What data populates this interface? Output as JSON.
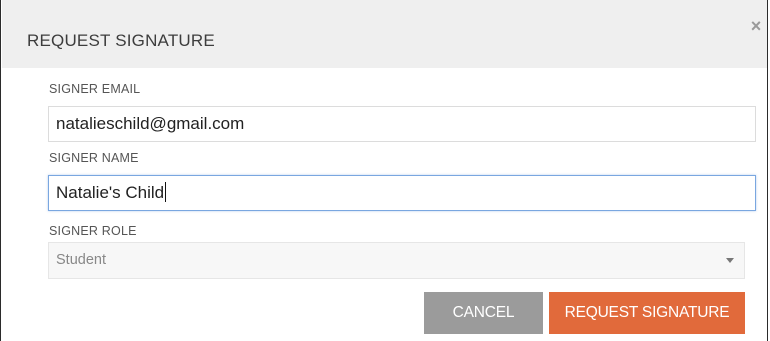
{
  "modal": {
    "title": "REQUEST SIGNATURE",
    "close_glyph": "×"
  },
  "fields": {
    "email": {
      "label": "SIGNER EMAIL",
      "value": "natalieschild@gmail.com"
    },
    "name": {
      "label": "SIGNER NAME",
      "value": "Natalie's Child"
    },
    "role": {
      "label": "SIGNER ROLE",
      "selected": "Student"
    }
  },
  "buttons": {
    "cancel_label": "CANCEL",
    "request_label": "REQUEST SIGNATURE"
  },
  "icons": {
    "close": "close-icon",
    "dropdown": "chevron-down-icon"
  },
  "colors": {
    "header_bg": "#efefef",
    "cancel_bg": "#9b9b9b",
    "primary_bg": "#e16a3b",
    "focus_border": "#7aa7e0"
  }
}
